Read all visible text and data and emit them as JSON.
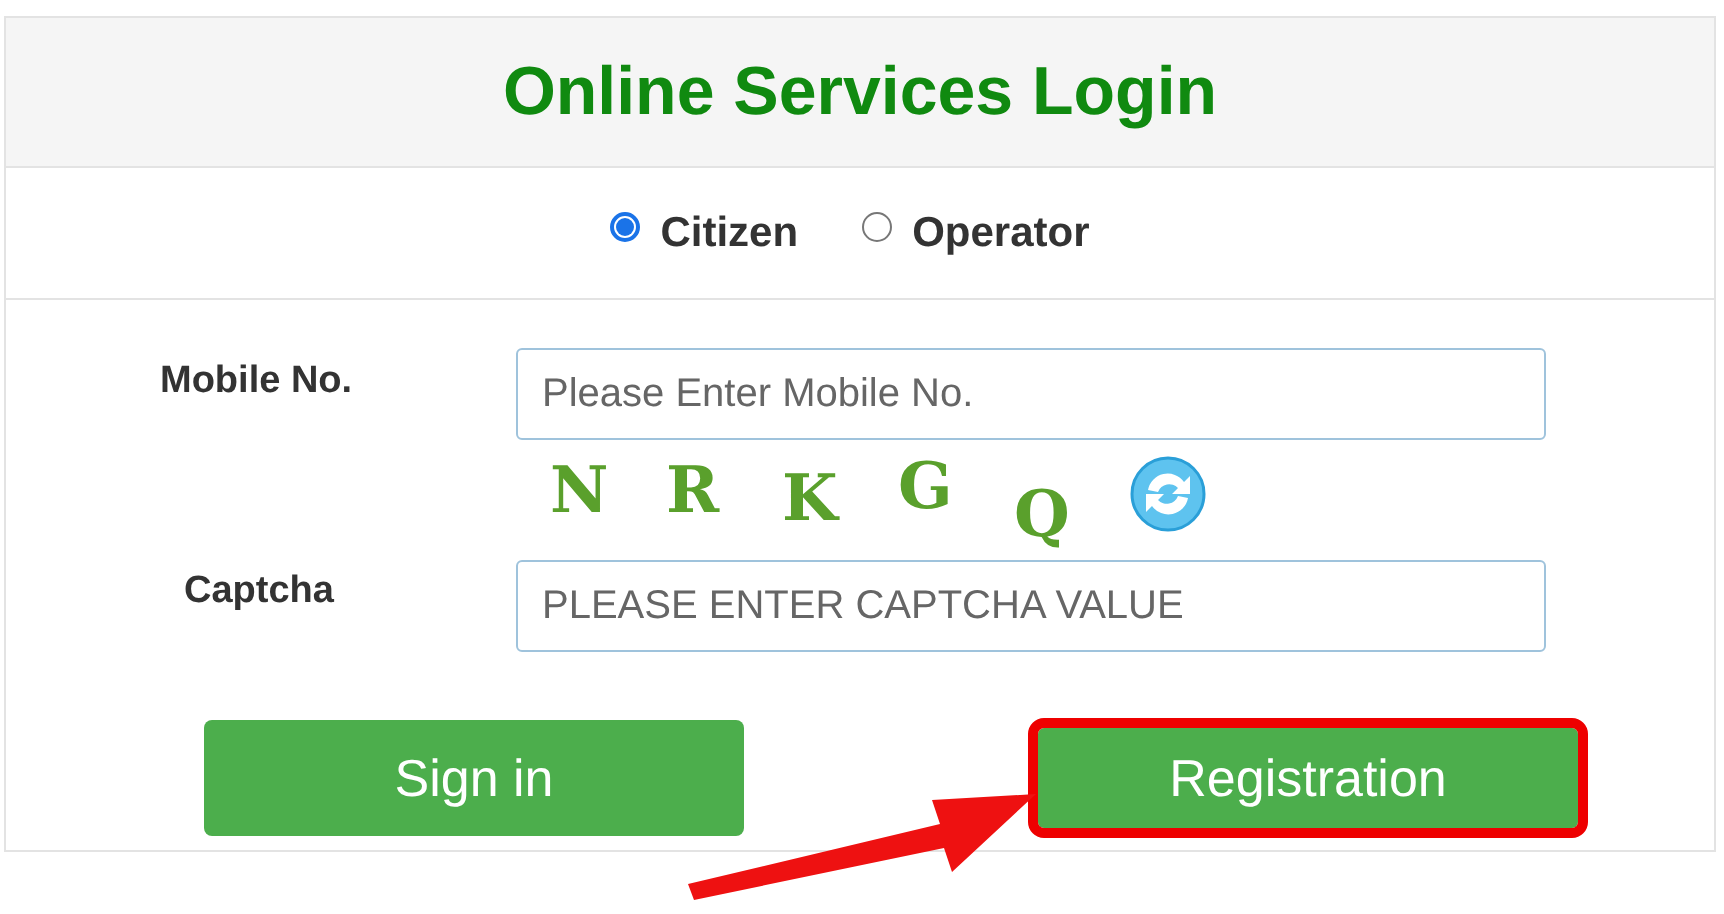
{
  "title": "Online Services Login",
  "user_types": [
    {
      "label": "Citizen",
      "selected": true
    },
    {
      "label": "Operator",
      "selected": false
    }
  ],
  "fields": [
    {
      "label": "Mobile No.",
      "placeholder": "Please Enter Mobile No."
    },
    {
      "label": "Captcha",
      "placeholder": "PLEASE ENTER CAPTCHA VALUE"
    }
  ],
  "captcha": {
    "letters": [
      "N",
      "R",
      "K",
      "G",
      "Q"
    ]
  },
  "buttons": [
    {
      "label": "Sign in",
      "highlighted": false
    },
    {
      "label": "Registration",
      "highlighted": true
    }
  ]
}
